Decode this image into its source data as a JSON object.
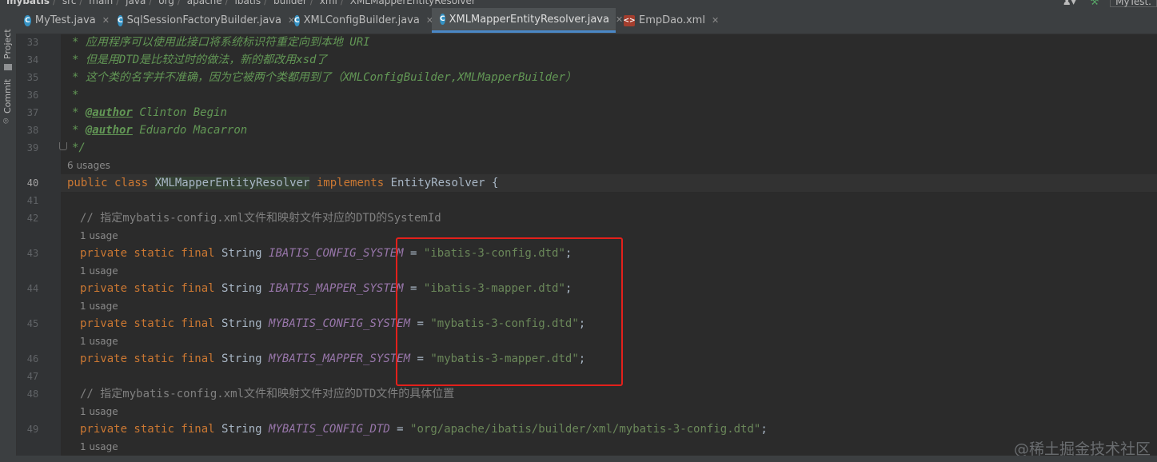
{
  "breadcrumb": {
    "items": [
      "mybatis",
      "src",
      "main",
      "java",
      "org",
      "apache",
      "ibatis",
      "builder",
      "xml",
      "XMLMapperEntityResolver"
    ],
    "run_config": "MyTest."
  },
  "tabs": [
    {
      "label": "MyTest.java",
      "icon": "class-icon"
    },
    {
      "label": "SqlSessionFactoryBuilder.java",
      "icon": "class-icon"
    },
    {
      "label": "XMLConfigBuilder.java",
      "icon": "class-icon"
    },
    {
      "label": "XMLMapperEntityResolver.java",
      "icon": "class-icon",
      "active": true
    },
    {
      "label": "EmpDao.xml",
      "icon": "xml-file-icon"
    }
  ],
  "tool_windows": [
    {
      "label": "Project"
    },
    {
      "label": "Commit"
    }
  ],
  "line_numbers": [
    "33",
    "34",
    "35",
    "36",
    "37",
    "38",
    "39",
    "40",
    "41",
    "42",
    "43",
    "44",
    "45",
    "46",
    "47",
    "48",
    "49"
  ],
  "hints": {
    "usages_6": "6 usages",
    "usage_1": "1 usage"
  },
  "code": {
    "l33": "应用程序可以使用此接口将系统标识符重定向到本地 URI",
    "l34": "但是用DTD是比较过时的做法，新的都改用xsd了",
    "l35": "这个类的名字并不准确，因为它被两个类都用到了（XMLConfigBuilder,XMLMapperBuilder）",
    "author_tag": "@author",
    "author1": "Clinton Begin",
    "author2": "Eduardo Macarron",
    "class_name": "XMLMapperEntityResolver",
    "iface": "EntityResolver",
    "comment1": "// 指定mybatis-config.xml文件和映射文件对应的DTD的SystemId",
    "comment2": "// 指定mybatis-config.xml文件和映射文件对应的DTD文件的具体位置",
    "fields": [
      {
        "name": "IBATIS_CONFIG_SYSTEM",
        "value": "\"ibatis-3-config.dtd\""
      },
      {
        "name": "IBATIS_MAPPER_SYSTEM",
        "value": "\"ibatis-3-mapper.dtd\""
      },
      {
        "name": "MYBATIS_CONFIG_SYSTEM",
        "value": "\"mybatis-3-config.dtd\""
      },
      {
        "name": "MYBATIS_MAPPER_SYSTEM",
        "value": "\"mybatis-3-mapper.dtd\""
      },
      {
        "name": "MYBATIS_CONFIG_DTD",
        "value": "\"org/apache/ibatis/builder/xml/mybatis-3-config.dtd\""
      }
    ]
  },
  "watermark": "@稀土掘金技术社区"
}
